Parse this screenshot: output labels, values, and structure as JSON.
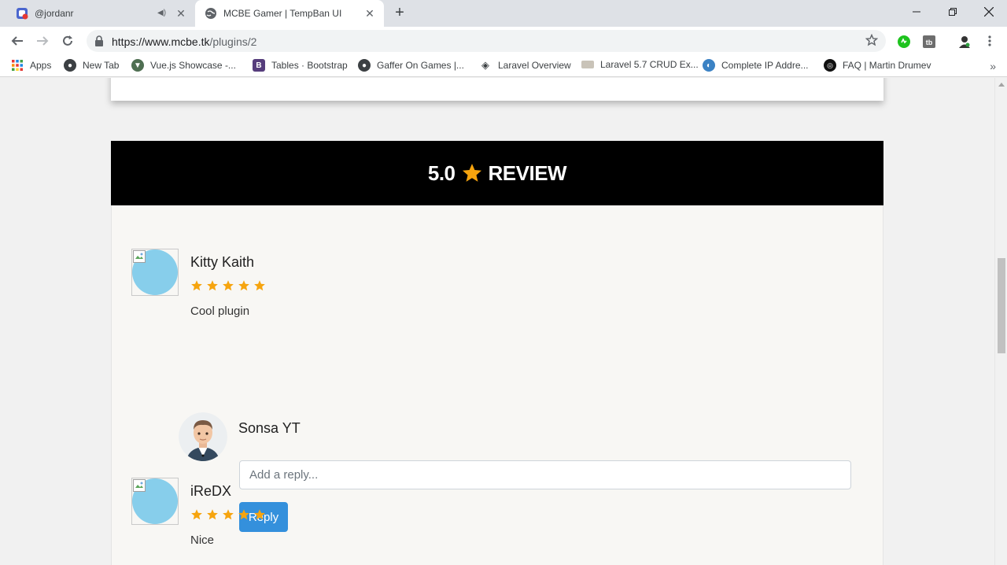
{
  "browser": {
    "tabs": [
      {
        "title": "@jordanr",
        "active": false
      },
      {
        "title": "MCBE Gamer | TempBan UI",
        "active": true
      }
    ],
    "url_host": "https://www.mcbe.tk",
    "url_path": "/plugins/2",
    "bookmarks": [
      {
        "label": "Apps",
        "icon": "apps-grid-icon"
      },
      {
        "label": "New Tab",
        "icon": "globe-icon"
      },
      {
        "label": "Vue.js Showcase -...",
        "icon": "vue-icon"
      },
      {
        "label": "Tables · Bootstrap",
        "icon": "bootstrap-icon"
      },
      {
        "label": "Gaffer On Games |...",
        "icon": "globe-icon"
      },
      {
        "label": "Laravel Overview",
        "icon": "laravel-icon"
      },
      {
        "label": "Laravel 5.7 CRUD Ex...",
        "icon": "page-icon"
      },
      {
        "label": "Complete IP Addre...",
        "icon": "earth-icon"
      },
      {
        "label": "FAQ | Martin Drumev",
        "icon": "faq-icon"
      }
    ]
  },
  "review_section": {
    "rating": "5.0",
    "heading": "REVIEW",
    "star_color": "#f6a40e"
  },
  "reviews": [
    {
      "name": "Kitty Kaith",
      "stars": 5,
      "text": "Cool plugin"
    },
    {
      "name": "iReDX",
      "stars": 5,
      "text": "Nice"
    }
  ],
  "reply_form": {
    "user": "Sonsa YT",
    "placeholder": "Add a reply...",
    "button": "Reply"
  }
}
